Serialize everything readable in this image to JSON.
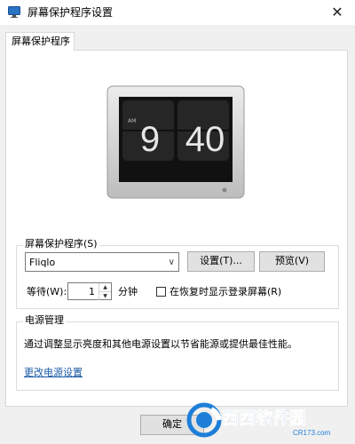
{
  "window": {
    "title": "屏幕保护程序设置",
    "close_glyph": "✕"
  },
  "tabs": [
    {
      "label": "屏幕保护程序"
    }
  ],
  "preview": {
    "hour": "9",
    "minute": "40",
    "meridiem": "AM",
    "bezel_color": "#cfcfcf",
    "screen_color": "#111111"
  },
  "screensaver_group": {
    "title": "屏幕保护程序(S)",
    "selected": "Fliqlo",
    "settings_button": "设置(T)...",
    "preview_button": "预览(V)",
    "wait_label": "等待(W):",
    "wait_value": "1",
    "minutes_label": "分钟",
    "resume_checkbox_label": "在恢复时显示登录屏幕(R)",
    "resume_checked": false
  },
  "power_group": {
    "title": "电源管理",
    "description": "通过调整显示亮度和其他电源设置以节省能源或提供最佳性能。",
    "link": "更改电源设置"
  },
  "footer": {
    "ok_button": "确定"
  },
  "watermark": {
    "text": "西西软件园",
    "url_text": "CR173.com",
    "accent": "#1e7fd8"
  }
}
